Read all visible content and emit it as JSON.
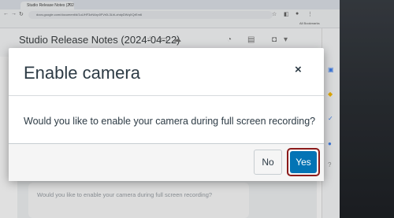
{
  "browser": {
    "tab_title": "Studio Release Notes (2024-…",
    "url": "docs.google.com/document/d/1uUHF3zN4xp0FVr0L3LhLzhdyDWqXQrEm6",
    "bookmarks": [
      "All Bookmarks"
    ]
  },
  "document": {
    "title": "Studio Release Notes (2024-04-22)",
    "background_text": "Would you like to enable your camera during full screen recording?"
  },
  "modal": {
    "title": "Enable camera",
    "close_symbol": "×",
    "question": "Would you like to enable your camera during full screen recording?",
    "no_label": "No",
    "yes_label": "Yes"
  },
  "colors": {
    "primary_button": "#0374b5",
    "focus_ring": "#8b1a1a",
    "text": "#2d3b45"
  },
  "icons": [
    "star-icon",
    "folder-icon",
    "cloud-icon",
    "history-icon",
    "comment-icon",
    "camera-icon",
    "chevron-down-icon",
    "close-icon",
    "back-icon",
    "forward-icon",
    "reload-icon",
    "calendar-icon",
    "keep-icon",
    "tasks-icon",
    "contacts-icon"
  ]
}
